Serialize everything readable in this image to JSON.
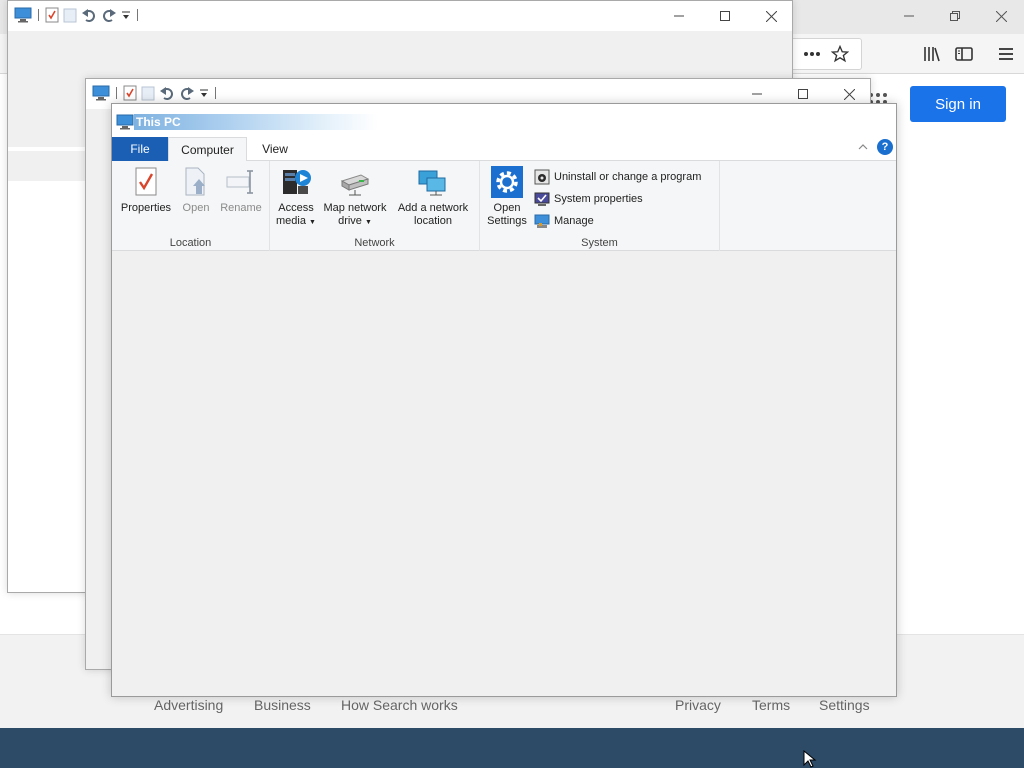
{
  "browser": {
    "signin_label": "Sign in",
    "footer_links_left": [
      "Advertising",
      "Business",
      "How Search works"
    ],
    "footer_links_right": [
      "Privacy",
      "Terms",
      "Settings"
    ],
    "colors": {
      "signin": "#1a73e8",
      "footer_dark": "#2d4a66"
    }
  },
  "explorer": {
    "title": "This PC",
    "tabs": [
      "File",
      "Computer",
      "View"
    ],
    "groups": {
      "location": {
        "label": "Location",
        "buttons": [
          "Properties",
          "Open",
          "Rename"
        ]
      },
      "network": {
        "label": "Network",
        "access_media": [
          "Access",
          "media"
        ],
        "map_network_drive": [
          "Map network",
          "drive"
        ],
        "add_network_location": [
          "Add a network",
          "location"
        ]
      },
      "system": {
        "label": "System",
        "open_settings": [
          "Open",
          "Settings"
        ],
        "commands": [
          "Uninstall or change a program",
          "System properties",
          "Manage"
        ]
      }
    },
    "help_glyph": "?"
  }
}
